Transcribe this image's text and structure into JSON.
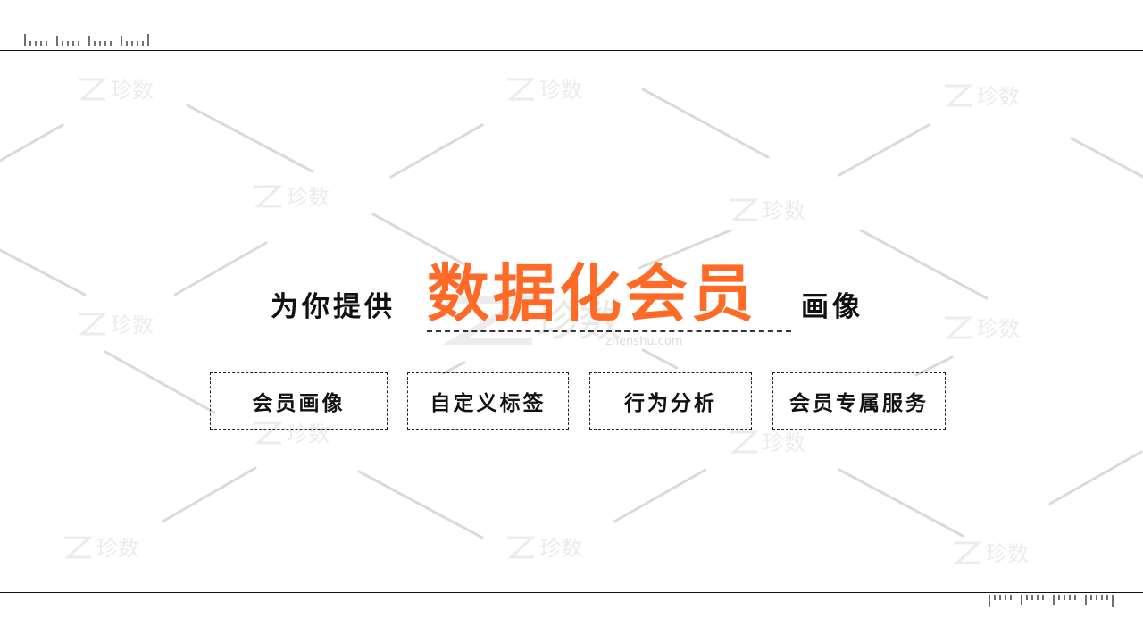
{
  "headline": {
    "prefix": "为你提供",
    "highlight": "数据化会员",
    "suffix": "画像"
  },
  "features": [
    {
      "label": "会员画像"
    },
    {
      "label": "自定义标签"
    },
    {
      "label": "行为分析"
    },
    {
      "label": "会员专属服务"
    }
  ],
  "watermark": {
    "brand": "珍数",
    "url": "zhenshu.com"
  },
  "colors": {
    "accent": "#ff6a26",
    "text": "#111111",
    "decor_line": "#d9d9d9",
    "watermark": "#e6e6e6"
  }
}
